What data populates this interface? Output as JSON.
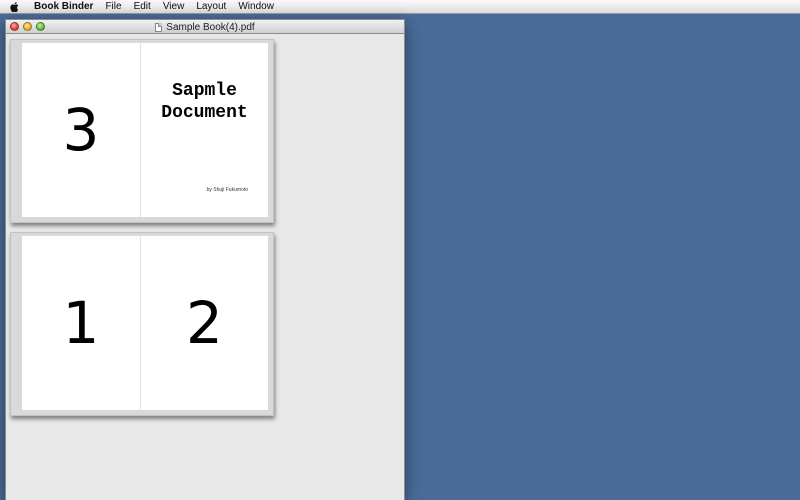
{
  "menubar": {
    "app_name": "Book Binder",
    "items": [
      "File",
      "Edit",
      "View",
      "Layout",
      "Window"
    ]
  },
  "window": {
    "title": "Sample Book(4).pdf"
  },
  "spreads": [
    {
      "left_page": "3",
      "right_page": {
        "title_line1": "Sapmle",
        "title_line2": "Document",
        "byline": "by Shuji Fukumoto"
      }
    },
    {
      "left_page": "1",
      "right_page": "2"
    }
  ],
  "colors": {
    "desktop": "#4a6b9a",
    "window_bg": "#e8e8e8",
    "page": "#ffffff"
  }
}
